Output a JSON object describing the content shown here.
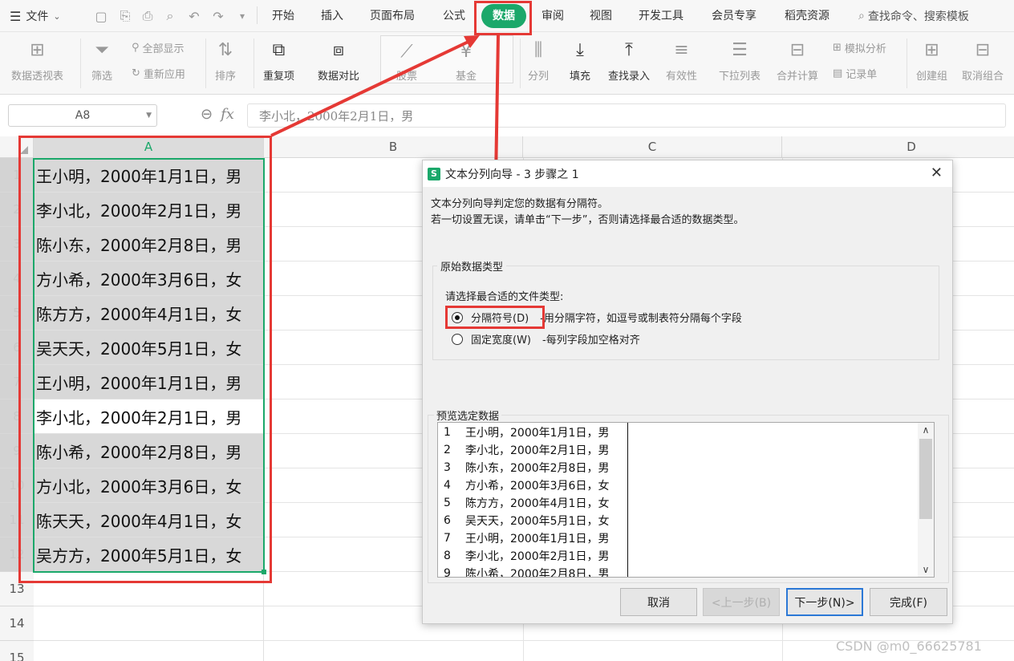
{
  "menubar": {
    "file": "文件",
    "tabs": [
      "开始",
      "插入",
      "页面布局",
      "公式",
      "数据",
      "审阅",
      "视图",
      "开发工具",
      "会员专享",
      "稻壳资源"
    ],
    "active_tab": "数据",
    "search": "查找命令、搜索模板",
    "accent": "#1ba86a"
  },
  "ribbon": {
    "pivot": "数据透视表",
    "filter": "筛选",
    "show_all": "全部显示",
    "reapply": "重新应用",
    "sort": "排序",
    "duplicates": "重复项",
    "compare": "数据对比",
    "stock": "股票",
    "fund": "基金",
    "split": "分列",
    "fill": "填充",
    "lookup": "查找录入",
    "validity": "有效性",
    "dropdown": "下拉列表",
    "consolidate": "合并计算",
    "whatif": "模拟分析",
    "record": "记录单",
    "group": "创建组",
    "ungroup": "取消组合"
  },
  "formula_bar": {
    "name_box": "A8",
    "fx": "fx",
    "value": "李小北，2000年2月1日，男"
  },
  "sheet": {
    "columns": [
      "A",
      "B",
      "C",
      "D"
    ],
    "selected_column": "A",
    "rows": [
      {
        "num": "1",
        "a": "王小明，2000年1月1日，男"
      },
      {
        "num": "2",
        "a": "李小北，2000年2月1日，男"
      },
      {
        "num": "3",
        "a": "陈小东，2000年2月8日，男"
      },
      {
        "num": "4",
        "a": "方小希，2000年3月6日，女"
      },
      {
        "num": "5",
        "a": "陈方方，2000年4月1日，女"
      },
      {
        "num": "6",
        "a": "吴天天，2000年5月1日，女"
      },
      {
        "num": "7",
        "a": "王小明，2000年1月1日，男"
      },
      {
        "num": "8",
        "a": "李小北，2000年2月1日，男"
      },
      {
        "num": "9",
        "a": "陈小希，2000年2月8日，男"
      },
      {
        "num": "10",
        "a": "方小北，2000年3月6日，女"
      },
      {
        "num": "11",
        "a": "陈天天，2000年4月1日，女"
      },
      {
        "num": "12",
        "a": "吴方方，2000年5月1日，女"
      },
      {
        "num": "13",
        "a": ""
      },
      {
        "num": "14",
        "a": ""
      },
      {
        "num": "15",
        "a": ""
      }
    ]
  },
  "dialog": {
    "title": "文本分列向导 - 3 步骤之 1",
    "desc1": "文本分列向导判定您的数据有分隔符。",
    "desc2": "若一切设置无误，请单击“下一步”，否则请选择最合适的数据类型。",
    "group_title": "原始数据类型",
    "prompt": "请选择最合适的文件类型:",
    "opt_delimited": "分隔符号(D)",
    "opt_delimited_desc": "-用分隔字符，如逗号或制表符分隔每个字段",
    "opt_fixed": "固定宽度(W)",
    "opt_fixed_desc": "-每列字段加空格对齐",
    "preview_title": "预览选定数据",
    "preview": [
      {
        "n": "1",
        "t": "王小明，2000年1月1日，男"
      },
      {
        "n": "2",
        "t": "李小北，2000年2月1日，男"
      },
      {
        "n": "3",
        "t": "陈小东，2000年2月8日，男"
      },
      {
        "n": "4",
        "t": "方小希，2000年3月6日，女"
      },
      {
        "n": "5",
        "t": "陈方方，2000年4月1日，女"
      },
      {
        "n": "6",
        "t": "吴天天，2000年5月1日，女"
      },
      {
        "n": "7",
        "t": "王小明，2000年1月1日，男"
      },
      {
        "n": "8",
        "t": "李小北，2000年2月1日，男"
      },
      {
        "n": "9",
        "t": "陈小希，2000年2月8日，男"
      }
    ],
    "btn_cancel": "取消",
    "btn_prev": "<上一步(B)",
    "btn_next": "下一步(N)>",
    "btn_finish": "完成(F)"
  },
  "watermark": "CSDN @m0_66625781"
}
